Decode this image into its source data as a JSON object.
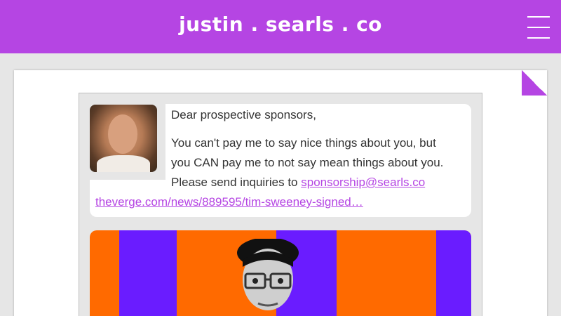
{
  "header": {
    "site_title": "justin . searls . co",
    "brand_color": "#b545e3",
    "menu_icon": "hamburger-menu-icon"
  },
  "post": {
    "greeting": "Dear prospective sponsors,",
    "body_line_1": "You can't pay me to say nice things about you, but",
    "body_line_2": "you CAN pay me to not say mean things about you.",
    "inquiries_prefix": "Please send inquiries to ",
    "email_link": "sponsorship@searls.co",
    "article_link": "theverge.com/news/889595/tim-sweeney-signed…",
    "link_color": "#b545e3"
  },
  "article_image": {
    "colors": [
      "#ff6a00",
      "#6a1cff"
    ]
  }
}
